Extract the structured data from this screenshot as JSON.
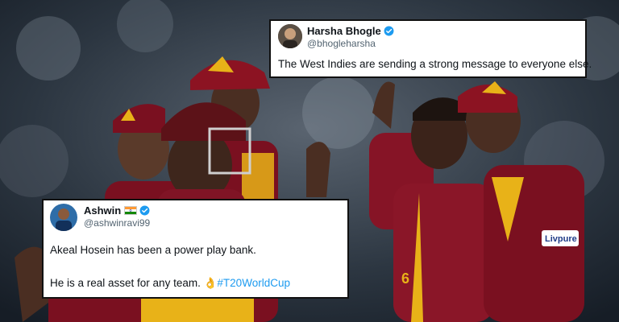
{
  "tweets": [
    {
      "name": "Harsha Bhogle",
      "handle": "@bhogleharsha",
      "verified": true,
      "text": "The West Indies are sending a strong message to everyone else."
    },
    {
      "name": "Ashwin",
      "flag": "india-flag",
      "handle": "@ashwinravi99",
      "verified": true,
      "line1": "Akeal Hosein has been a power play bank.",
      "line2_prefix": "He is a real asset for any team.",
      "line2_emoji": "👌",
      "hashtag": "#T20WorldCup"
    }
  ],
  "photo": {
    "jersey_sponsor": "Livpure",
    "player_number": "6",
    "colors": {
      "maroon": "#7a1020",
      "gold": "#e8b218",
      "verified_blue": "#1d9bf0"
    }
  }
}
